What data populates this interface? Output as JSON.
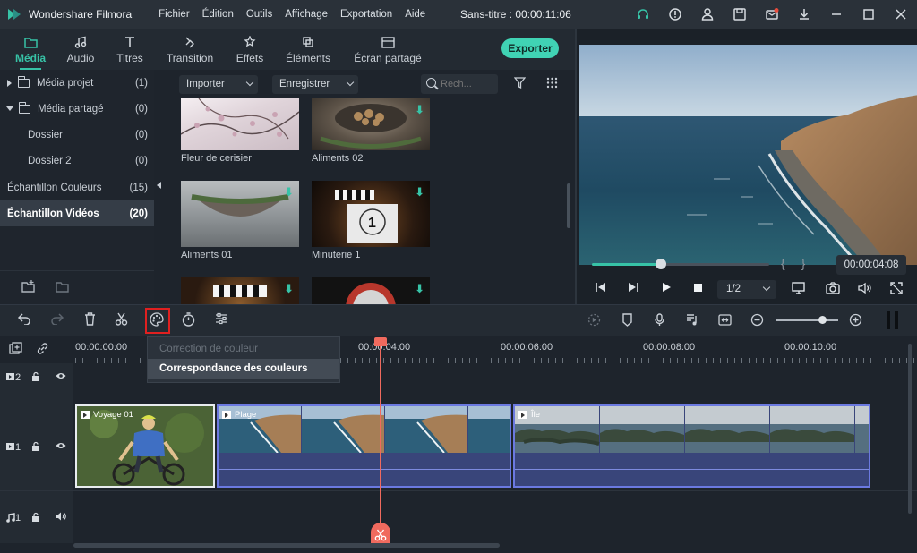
{
  "app": {
    "name": "Wondershare Filmora",
    "title": "Sans-titre : 00:00:11:06",
    "menu": [
      "Fichier",
      "Édition",
      "Outils",
      "Affichage",
      "Exportation",
      "Aide"
    ],
    "accent_color": "#37c3a7",
    "window_icons": [
      "headset-icon",
      "info-icon",
      "user-icon",
      "save-icon",
      "mail-icon",
      "download-icon",
      "minimize-icon",
      "maximize-icon",
      "close-icon"
    ]
  },
  "tabs": [
    {
      "label": "Média",
      "icon": "folder-icon",
      "active": true
    },
    {
      "label": "Audio",
      "icon": "music-icon",
      "active": false
    },
    {
      "label": "Titres",
      "icon": "text-icon",
      "active": false
    },
    {
      "label": "Transition",
      "icon": "transition-icon",
      "active": false
    },
    {
      "label": "Effets",
      "icon": "effects-icon",
      "active": false
    },
    {
      "label": "Éléments",
      "icon": "elements-icon",
      "active": false
    },
    {
      "label": "Écran partagé",
      "icon": "split-screen-icon",
      "active": false
    }
  ],
  "export_label": "Exporter",
  "library": {
    "items": [
      {
        "label": "Média projet",
        "count": "(1)",
        "expand": "collapsed"
      },
      {
        "label": "Média partagé",
        "count": "(0)",
        "expand": "expanded"
      },
      {
        "label": "Dossier",
        "count": "(0)"
      },
      {
        "label": "Dossier 2",
        "count": "(0)"
      },
      {
        "label": "Échantillon Couleurs",
        "count": "(15)"
      },
      {
        "label": "Échantillon Vidéos",
        "count": "(20)",
        "active": true
      }
    ]
  },
  "media": {
    "import_label": "Importer",
    "record_label": "Enregistrer",
    "search_placeholder": "Rech...",
    "thumbs": [
      {
        "label": "Fleur de cerisier",
        "downloadable": false
      },
      {
        "label": "Aliments 02",
        "downloadable": true
      },
      {
        "label": "Aliments 01",
        "downloadable": true
      },
      {
        "label": "Minuterie 1",
        "downloadable": true
      },
      {
        "label": "",
        "downloadable": true
      },
      {
        "label": "",
        "downloadable": true
      }
    ]
  },
  "preview": {
    "timecode": "00:00:04:08",
    "zoom": "1/2",
    "progress": 0.39
  },
  "timeline": {
    "ruler": [
      "00:00:00:00",
      "00:00:04:00",
      "00:00:06:00",
      "00:00:08:00",
      "00:00:10:00"
    ],
    "context_menu": {
      "disabled_item": "Correction de couleur",
      "selected_item": "Correspondance des couleurs"
    },
    "tracks": [
      {
        "id": "2",
        "type": "video"
      },
      {
        "id": "1",
        "type": "video"
      },
      {
        "id": "1",
        "type": "audio"
      }
    ],
    "clips": [
      {
        "label": "Voyage 01"
      },
      {
        "label": "Plage"
      },
      {
        "label": "Île"
      }
    ]
  }
}
